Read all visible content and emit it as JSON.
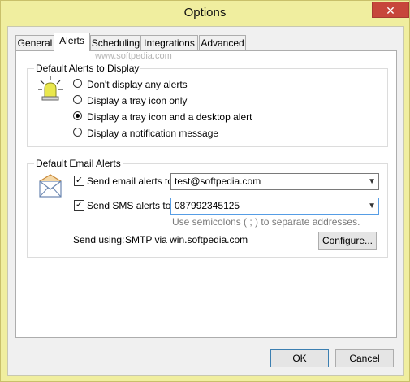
{
  "window": {
    "title": "Options",
    "close_glyph": "✕"
  },
  "tabs": [
    {
      "label": "General",
      "active": false
    },
    {
      "label": "Alerts",
      "active": true
    },
    {
      "label": "Scheduling",
      "active": false
    },
    {
      "label": "Integrations",
      "active": false
    },
    {
      "label": "Advanced",
      "active": false
    }
  ],
  "watermark": "www.softpedia.com",
  "alerts_group": {
    "title": "Default Alerts to Display",
    "icon": "alert-light-icon",
    "options": [
      {
        "label": "Don't display any alerts",
        "selected": false
      },
      {
        "label": "Display a tray icon only",
        "selected": false
      },
      {
        "label": "Display a tray icon and a desktop alert",
        "selected": true
      },
      {
        "label": "Display a notification message",
        "selected": false
      }
    ]
  },
  "email_group": {
    "title": "Default Email Alerts",
    "icon": "envelope-icon",
    "email": {
      "label": "Send email alerts to:",
      "checked": true,
      "value": "test@softpedia.com"
    },
    "sms": {
      "label": "Send SMS alerts to:",
      "checked": true,
      "value": "087992345125"
    },
    "hint": "Use semicolons ( ; ) to separate addresses.",
    "send_using_label": "Send using:",
    "send_using_value": "SMTP via win.softpedia.com",
    "configure_label": "Configure..."
  },
  "footer": {
    "ok_label": "OK",
    "cancel_label": "Cancel"
  },
  "colors": {
    "frame": "#f0ee9f",
    "close": "#c7463b",
    "focus": "#569de5"
  }
}
